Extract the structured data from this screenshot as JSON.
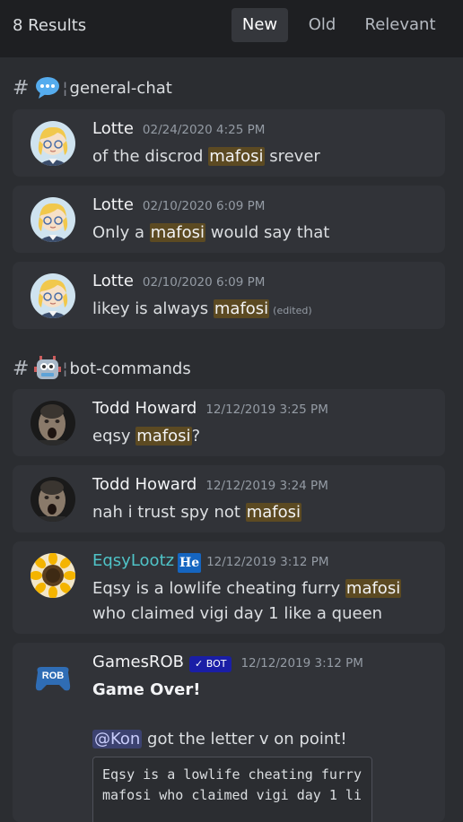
{
  "header": {
    "results": "8 Results",
    "tabs": [
      {
        "label": "New",
        "active": true
      },
      {
        "label": "Old",
        "active": false
      },
      {
        "label": "Relevant",
        "active": false
      }
    ]
  },
  "channels": [
    {
      "name": "general-chat",
      "icon": "speech-bubble-icon",
      "messages": [
        {
          "author": "Lotte",
          "timestamp": "02/24/2020 4:25 PM",
          "pre": "of the discrod ",
          "highlight": "mafosi",
          "post": " srever"
        },
        {
          "author": "Lotte",
          "timestamp": "02/10/2020 6:09 PM",
          "pre": "Only a ",
          "highlight": "mafosi",
          "post": " would say that"
        },
        {
          "author": "Lotte",
          "timestamp": "02/10/2020 6:09 PM",
          "pre": "likey is always ",
          "highlight": "mafosi",
          "post": "",
          "edited": "(edited)"
        }
      ]
    },
    {
      "name": "bot-commands",
      "icon": "robot-icon",
      "messages": [
        {
          "author": "Todd Howard",
          "timestamp": "12/12/2019 3:25 PM",
          "pre": "eqsy ",
          "highlight": "mafosi",
          "post": "?"
        },
        {
          "author": "Todd Howard",
          "timestamp": "12/12/2019 3:24 PM",
          "pre": "nah i trust spy not ",
          "highlight": "mafosi",
          "post": ""
        },
        {
          "author": "EqsyLootz",
          "role_badge": "He",
          "timestamp": "12/12/2019 3:12 PM",
          "pre": "Eqsy is a lowlife cheating furry ",
          "highlight": "mafosi",
          "post": " who claimed vigi day 1 like a queen"
        },
        {
          "author": "GamesROB",
          "bot_badge": "✓ BOT",
          "avatar_text": "ROB",
          "timestamp": "12/12/2019 3:12 PM",
          "title": "Game Over!",
          "mention": "@Kon",
          "line_after_mention": " got the letter v on point!",
          "code": "Eqsy is a lowlife cheating furry mafosi who claimed vigi day 1 li"
        }
      ]
    }
  ],
  "colors": {
    "background": "#2b2d31",
    "card": "#313338",
    "header": "#1e1f22",
    "highlight": "#5c4a22",
    "mention": "#3c4270",
    "teal_name": "#4fc3c7"
  }
}
